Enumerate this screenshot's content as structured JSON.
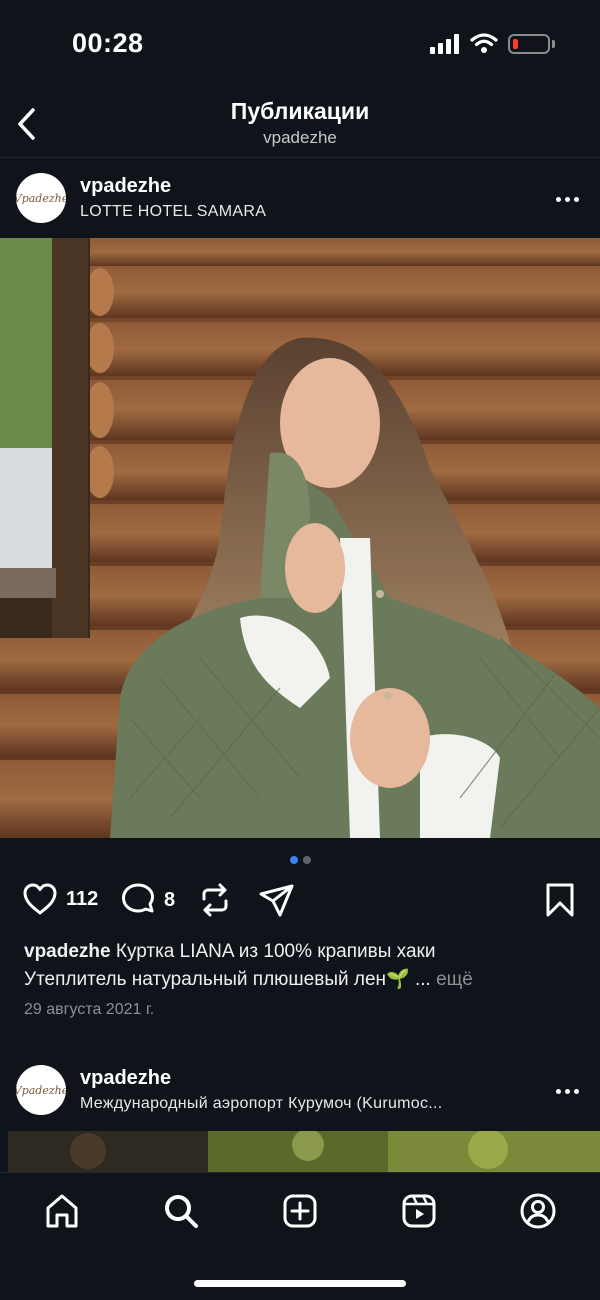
{
  "status": {
    "time": "00:28"
  },
  "nav": {
    "title": "Публикации",
    "subtitle": "vpadezhe"
  },
  "post1": {
    "username": "vpadezhe",
    "location": "LOTTE HOTEL SAMARA",
    "avatar_text": "Vpadezhe",
    "likes": "112",
    "comments": "8",
    "caption_user": "vpadezhe",
    "caption_line1": " Куртка LIANA из 100% крапивы хаки",
    "caption_line2": "Утеплитель натуральный плюшевый лен🌱 ... ",
    "more_label": "ещё",
    "date": "29 августа 2021 г.",
    "carousel": {
      "count": 2,
      "active": 0
    }
  },
  "post2": {
    "username": "vpadezhe",
    "location": "Международный аэропорт Курумоч (Kurumoc...",
    "avatar_text": "Vpadezhe"
  },
  "icons": {
    "back": "chevron-left-icon",
    "more": "more-horizontal-icon",
    "like": "heart-icon",
    "comment": "comment-icon",
    "repost": "repost-icon",
    "share": "send-icon",
    "save": "bookmark-icon",
    "tabs": [
      "home-icon",
      "search-icon",
      "create-icon",
      "reels-icon",
      "profile-icon"
    ]
  },
  "colors": {
    "background": "#0f131a",
    "accent": "#3b82f6",
    "muted": "#8e8e93"
  }
}
